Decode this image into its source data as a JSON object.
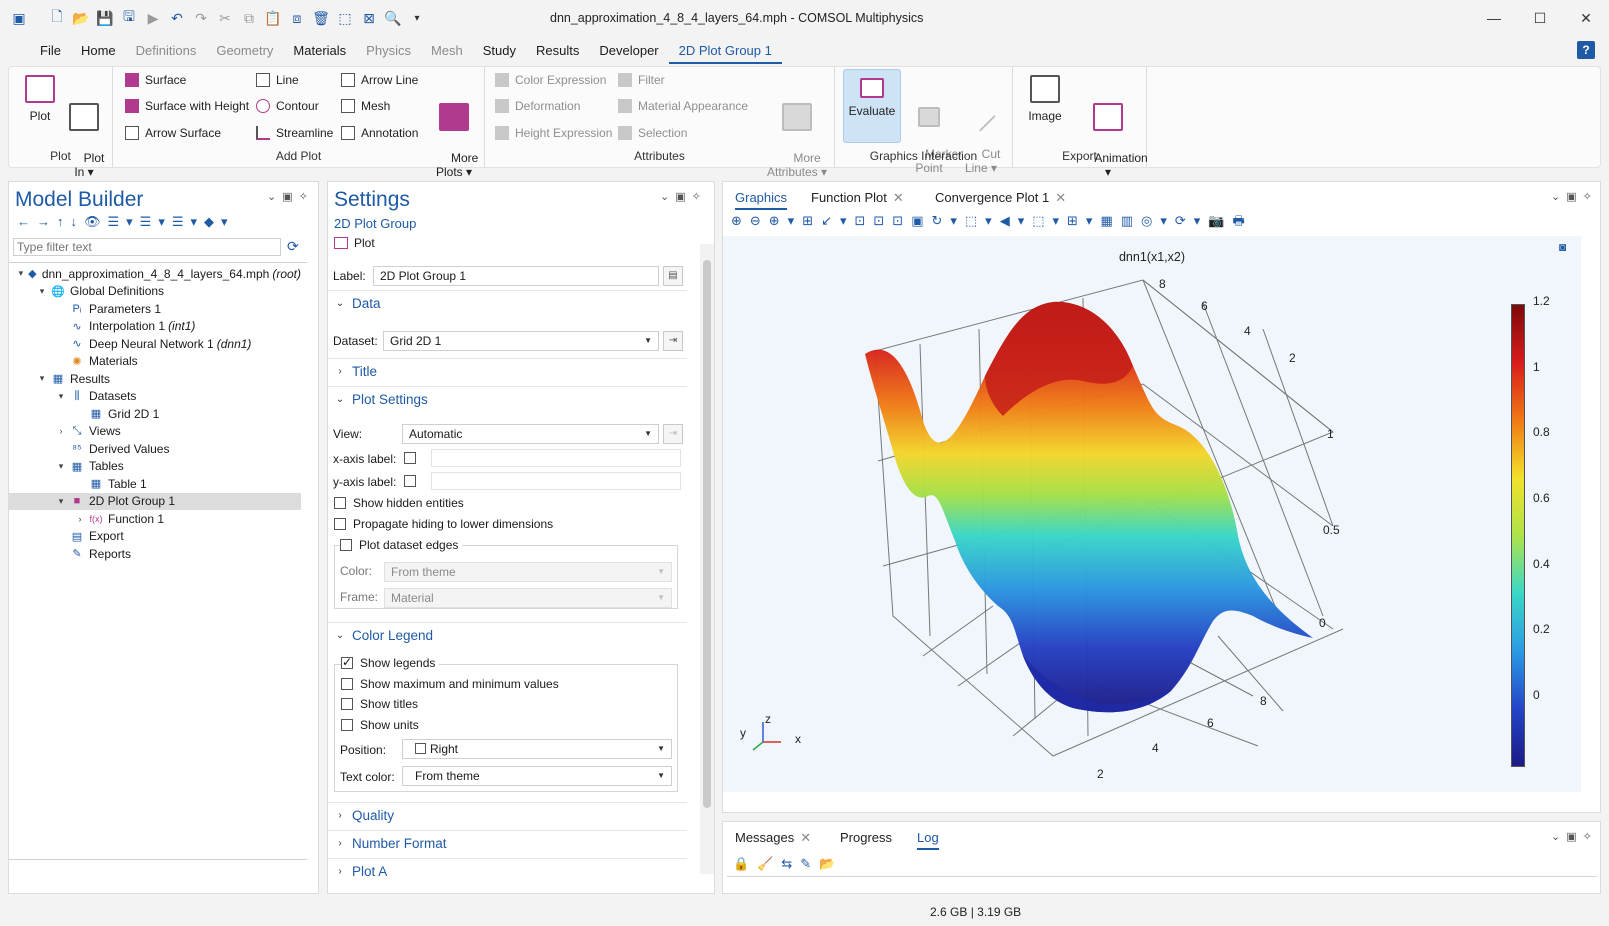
{
  "window": {
    "title": "dnn_approximation_4_8_4_layers_64.mph - COMSOL Multiphysics",
    "controls": [
      "minimize-icon",
      "maximize-icon",
      "close-icon"
    ]
  },
  "menu": {
    "tabs": [
      {
        "label": "File",
        "enabled": true
      },
      {
        "label": "Home",
        "enabled": true
      },
      {
        "label": "Definitions",
        "enabled": false
      },
      {
        "label": "Geometry",
        "enabled": false
      },
      {
        "label": "Materials",
        "enabled": true
      },
      {
        "label": "Physics",
        "enabled": false
      },
      {
        "label": "Mesh",
        "enabled": false
      },
      {
        "label": "Study",
        "enabled": true
      },
      {
        "label": "Results",
        "enabled": true
      },
      {
        "label": "Developer",
        "enabled": true
      },
      {
        "label": "2D Plot Group 1",
        "enabled": true,
        "active": true
      }
    ],
    "help": "?"
  },
  "ribbon": {
    "plot_group": {
      "title": "Plot",
      "plot": "Plot",
      "plot_in": "Plot\nIn ▾"
    },
    "add_plot": {
      "title": "Add Plot",
      "surface": "Surface",
      "surface_height": "Surface with Height",
      "arrow_surface": "Arrow Surface",
      "line": "Line",
      "contour": "Contour",
      "streamline": "Streamline",
      "arrow_line": "Arrow Line",
      "mesh": "Mesh",
      "annotation": "Annotation",
      "more_plots": "More\nPlots ▾"
    },
    "attributes": {
      "title": "Attributes",
      "color_expression": "Color Expression",
      "deformation": "Deformation",
      "height_expression": "Height Expression",
      "filter": "Filter",
      "material_appearance": "Material Appearance",
      "selection": "Selection",
      "more_attributes": "More\nAttributes ▾"
    },
    "graphics_interaction": {
      "title": "Graphics Interaction",
      "evaluate": "Evaluate",
      "marker_point": "Marker\nPoint",
      "cut_line": "Cut\nLine ▾"
    },
    "export": {
      "title": "Export",
      "image": "Image",
      "animation": "Animation\n▾"
    }
  },
  "model_builder": {
    "title": "Model Builder",
    "filter_placeholder": "Type filter text",
    "tree": [
      {
        "label": "dnn_approximation_4_8_4_layers_64.mph",
        "tag": "(root)",
        "level": 0,
        "toggle": "▾",
        "icon": "model-icon"
      },
      {
        "label": "Global Definitions",
        "level": 1,
        "toggle": "▾",
        "icon": "globe-icon"
      },
      {
        "label": "Parameters 1",
        "level": 2,
        "toggle": "",
        "icon": "parameters-icon"
      },
      {
        "label": "Interpolation 1",
        "tag": "(int1)",
        "level": 2,
        "toggle": "",
        "icon": "interpolation-icon"
      },
      {
        "label": "Deep Neural Network 1",
        "tag": "(dnn1)",
        "level": 2,
        "toggle": "",
        "icon": "neural-network-icon"
      },
      {
        "label": "Materials",
        "level": 2,
        "toggle": "",
        "icon": "materials-icon"
      },
      {
        "label": "Results",
        "level": 1,
        "toggle": "▾",
        "icon": "results-icon"
      },
      {
        "label": "Datasets",
        "level": 2,
        "toggle": "▾",
        "icon": "datasets-icon"
      },
      {
        "label": "Grid 2D 1",
        "level": 3,
        "toggle": "",
        "icon": "grid-icon"
      },
      {
        "label": "Views",
        "level": 2,
        "toggle": "›",
        "icon": "views-icon"
      },
      {
        "label": "Derived Values",
        "level": 2,
        "toggle": "",
        "icon": "derived-values-icon"
      },
      {
        "label": "Tables",
        "level": 2,
        "toggle": "▾",
        "icon": "tables-icon"
      },
      {
        "label": "Table 1",
        "level": 3,
        "toggle": "",
        "icon": "table-icon"
      },
      {
        "label": "2D Plot Group 1",
        "level": 2,
        "toggle": "▾",
        "icon": "plot-group-icon",
        "selected": true
      },
      {
        "label": "Function 1",
        "level": 3,
        "toggle": "›",
        "icon": "function-icon"
      },
      {
        "label": "Export",
        "level": 2,
        "toggle": "",
        "icon": "export-icon"
      },
      {
        "label": "Reports",
        "level": 2,
        "toggle": "",
        "icon": "reports-icon"
      }
    ]
  },
  "settings": {
    "title": "Settings",
    "subtitle": "2D Plot Group",
    "plot_button": "Plot",
    "label_caption": "Label:",
    "label_value": "2D Plot Group 1",
    "data_section": "Data",
    "dataset_caption": "Dataset:",
    "dataset_value": "Grid 2D 1",
    "title_section": "Title",
    "plot_settings_section": "Plot Settings",
    "view_caption": "View:",
    "view_value": "Automatic",
    "xaxis_caption": "x-axis label:",
    "yaxis_caption": "y-axis label:",
    "show_hidden": "Show hidden entities",
    "propagate_hiding": "Propagate hiding to lower dimensions",
    "plot_dataset_edges": "Plot dataset edges",
    "color_caption": "Color:",
    "color_value": "From theme",
    "frame_caption": "Frame:",
    "frame_value": "Material",
    "color_legend_section": "Color Legend",
    "show_legends": "Show legends",
    "show_maxmin": "Show maximum and minimum values",
    "show_titles": "Show titles",
    "show_units": "Show units",
    "position_caption": "Position:",
    "position_value": "Right",
    "text_color_caption": "Text color:",
    "text_color_value": "From theme",
    "quality_section": "Quality",
    "number_format_section": "Number Format",
    "plot_array_section": "Plot A"
  },
  "graphics": {
    "tabs": [
      "Graphics",
      "Function Plot",
      "Convergence Plot 1"
    ],
    "plot_title": "dnn1(x1,x2)",
    "colorbar_ticks": [
      "1.2",
      "1",
      "0.8",
      "0.6",
      "0.4",
      "0.2",
      "0"
    ],
    "axis_ticks_right": [
      "8",
      "6",
      "4",
      "2"
    ],
    "axis_ticks_z": [
      "1",
      "0.5",
      "0"
    ],
    "axis_ticks_front": [
      "8",
      "6",
      "4",
      "2"
    ],
    "triad": [
      "z",
      "y",
      "x"
    ]
  },
  "messages": {
    "tabs": [
      "Messages",
      "Progress",
      "Log"
    ]
  },
  "status": {
    "memory": "2.6 GB | 3.19 GB"
  }
}
